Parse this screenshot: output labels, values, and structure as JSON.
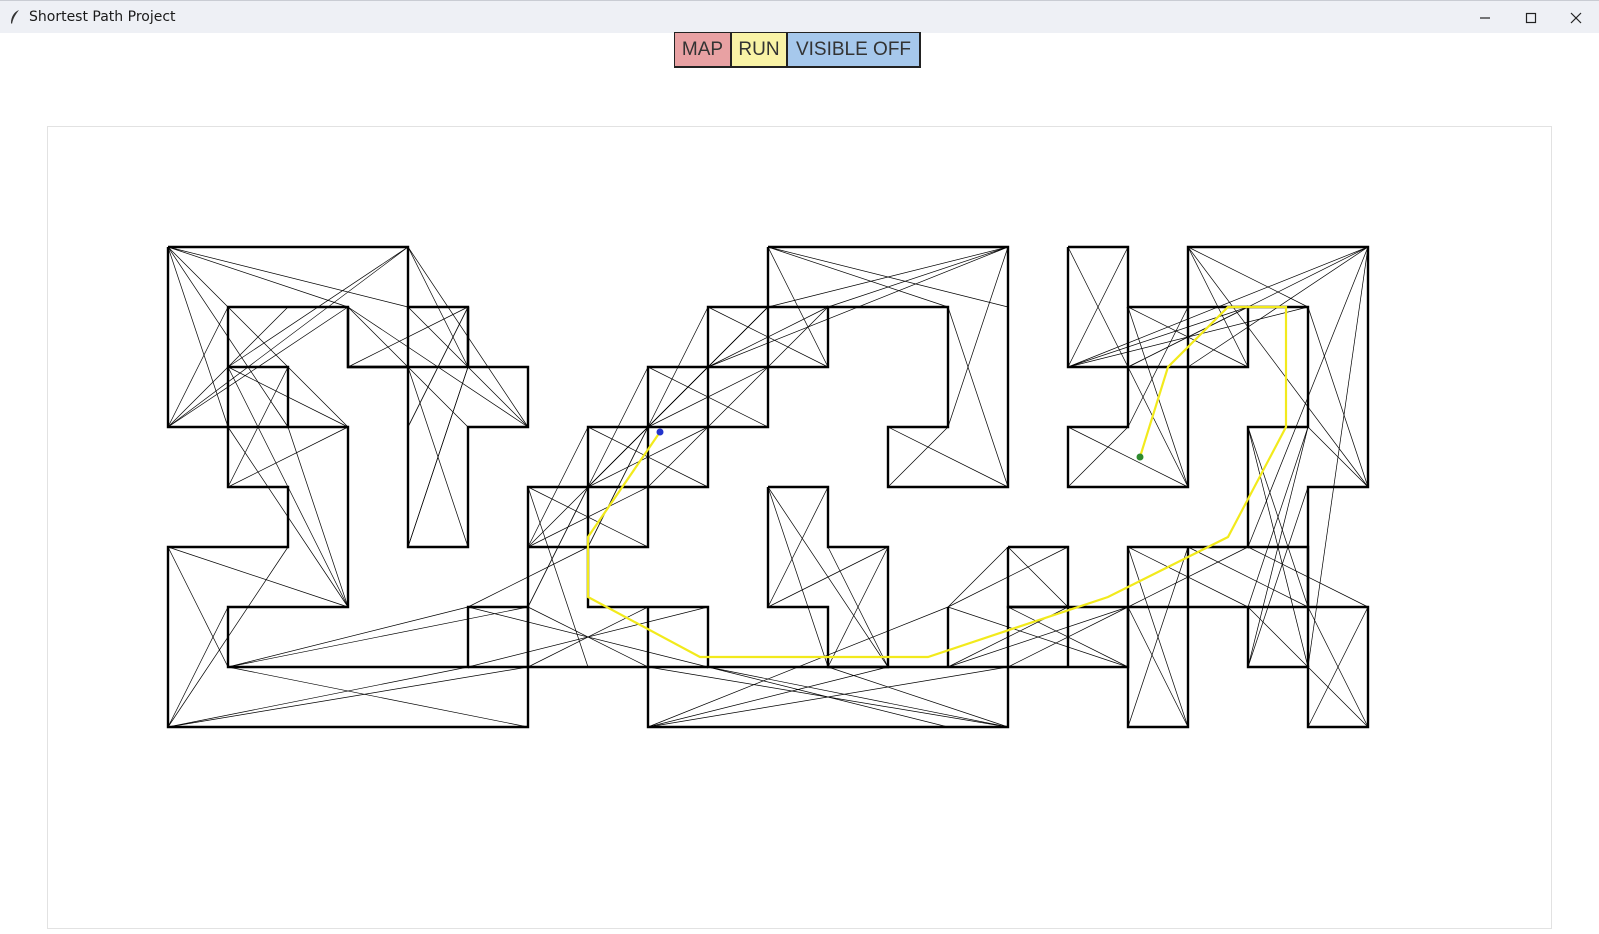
{
  "window": {
    "title": "Shortest Path Project"
  },
  "toolbar": {
    "map_label": "MAP",
    "run_label": "RUN",
    "visible_label": "VISIBLE OFF"
  },
  "colors": {
    "map_button": "#e8a1a3",
    "run_button": "#f9f3a6",
    "visible_button": "#a6c8ec",
    "path": "#f2ea1c",
    "start_point": "#2e8b2e",
    "goal_point": "#2233cc",
    "obstacle": "#000000",
    "visibility_edge": "#000000"
  },
  "icons": {
    "app": "feather-icon",
    "minimize": "minimize-icon",
    "maximize": "maximize-icon",
    "close": "close-icon"
  }
}
